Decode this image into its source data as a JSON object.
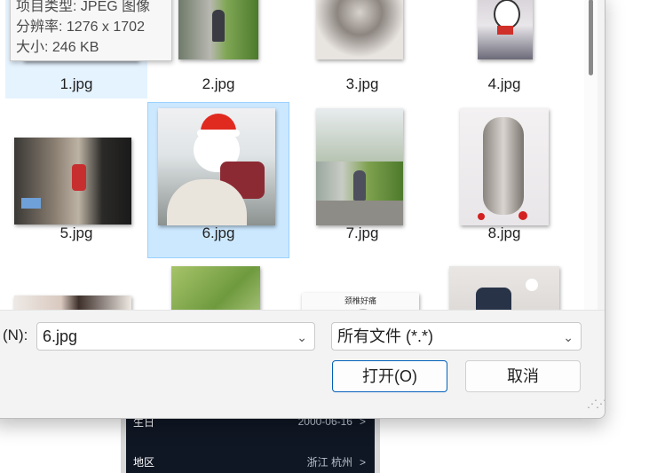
{
  "background_panel": {
    "rows": [
      {
        "label": "生日",
        "value": "2000-06-16"
      },
      {
        "label": "地区",
        "value": "浙江 杭州"
      }
    ],
    "chevron": ">"
  },
  "tooltip": {
    "type_line": "项目类型: JPEG 图像",
    "dims_line": "分辨率: 1276 x 1702",
    "size_line": "大小: 246 KB"
  },
  "files": [
    {
      "name": "1.jpg"
    },
    {
      "name": "2.jpg"
    },
    {
      "name": "3.jpg"
    },
    {
      "name": "4.jpg"
    },
    {
      "name": "5.jpg"
    },
    {
      "name": "6.jpg"
    },
    {
      "name": "7.jpg"
    },
    {
      "name": "8.jpg"
    }
  ],
  "partial_thumb_text": "颈椎好痛",
  "footer": {
    "filename_label": "(N):",
    "filename_value": "6.jpg",
    "filetype_value": "所有文件 (*.*)",
    "open_label": "打开(O)",
    "cancel_label": "取消"
  },
  "colors": {
    "selected_bg": "#cce8ff",
    "hover_bg": "#e5f3ff",
    "accent": "#005fb8"
  }
}
